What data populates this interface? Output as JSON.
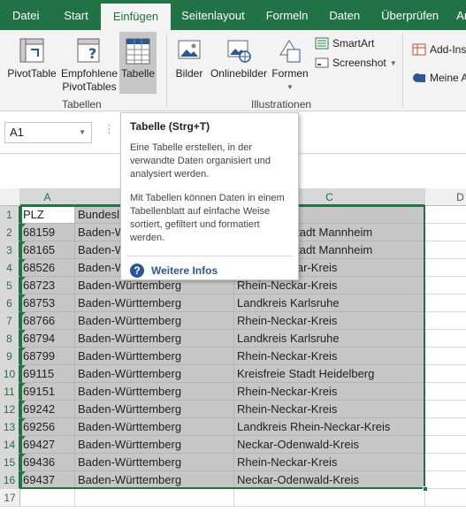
{
  "tabs": [
    "Datei",
    "Start",
    "Einfügen",
    "Seitenlayout",
    "Formeln",
    "Daten",
    "Überprüfen",
    "Ansi"
  ],
  "ribbon": {
    "pivottable": "PivotTable",
    "empfohlene_1": "Empfohlene",
    "empfohlene_2": "PivotTables",
    "tabelle": "Tabelle",
    "bilder": "Bilder",
    "onlinebilder": "Onlinebilder",
    "formen": "Formen",
    "smartart": "SmartArt",
    "screenshot": "Screenshot",
    "addins": "Add-Ins",
    "meine": "Meine A",
    "group_tabellen": "Tabellen",
    "group_illustrationen": "Illustrationen"
  },
  "formula": {
    "namebox": "A1"
  },
  "columns": [
    "A",
    "B",
    "C",
    "D"
  ],
  "rows": [
    {
      "n": "1",
      "a": "PLZ",
      "b": "Bundesl",
      "c": "",
      "marker": false
    },
    {
      "n": "2",
      "a": "68159",
      "b": "Baden-W",
      "c": "Kreisfreie Stadt Mannheim",
      "marker": true
    },
    {
      "n": "3",
      "a": "68165",
      "b": "Baden-W",
      "c": "Kreisfreie Stadt Mannheim",
      "marker": true
    },
    {
      "n": "4",
      "a": "68526",
      "b": "Baden-W",
      "c": "Rhein-Neckar-Kreis",
      "marker": true
    },
    {
      "n": "5",
      "a": "68723",
      "b": "Baden-Württemberg",
      "c": "Rhein-Neckar-Kreis",
      "marker": true
    },
    {
      "n": "6",
      "a": "68753",
      "b": "Baden-Württemberg",
      "c": "Landkreis Karlsruhe",
      "marker": true
    },
    {
      "n": "7",
      "a": "68766",
      "b": "Baden-Württemberg",
      "c": "Rhein-Neckar-Kreis",
      "marker": true
    },
    {
      "n": "8",
      "a": "68794",
      "b": "Baden-Württemberg",
      "c": "Landkreis Karlsruhe",
      "marker": true
    },
    {
      "n": "9",
      "a": "68799",
      "b": "Baden-Württemberg",
      "c": "Rhein-Neckar-Kreis",
      "marker": true
    },
    {
      "n": "10",
      "a": "69115",
      "b": "Baden-Württemberg",
      "c": "Kreisfreie Stadt Heidelberg",
      "marker": true
    },
    {
      "n": "11",
      "a": "69151",
      "b": "Baden-Württemberg",
      "c": "Rhein-Neckar-Kreis",
      "marker": true
    },
    {
      "n": "12",
      "a": "69242",
      "b": "Baden-Württemberg",
      "c": "Rhein-Neckar-Kreis",
      "marker": true
    },
    {
      "n": "13",
      "a": "69256",
      "b": "Baden-Württemberg",
      "c": "Landkreis Rhein-Neckar-Kreis",
      "marker": true
    },
    {
      "n": "14",
      "a": "69427",
      "b": "Baden-Württemberg",
      "c": "Neckar-Odenwald-Kreis",
      "marker": true
    },
    {
      "n": "15",
      "a": "69436",
      "b": "Baden-Württemberg",
      "c": "Rhein-Neckar-Kreis",
      "marker": true
    },
    {
      "n": "16",
      "a": "69437",
      "b": "Baden-Württemberg",
      "c": "Neckar-Odenwald-Kreis",
      "marker": true
    },
    {
      "n": "17",
      "a": "",
      "b": "",
      "c": "",
      "marker": false
    }
  ],
  "tooltip": {
    "title": "Tabelle (Strg+T)",
    "p1": "Eine Tabelle erstellen, in der verwandte Daten organisiert und analysiert werden.",
    "p2": "Mit Tabellen können Daten in einem Tabellenblatt auf einfache Weise sortiert, gefiltert und formatiert werden.",
    "link": "Weitere Infos"
  },
  "colors": {
    "accent": "#217346",
    "selection": "#c6c6c6"
  }
}
